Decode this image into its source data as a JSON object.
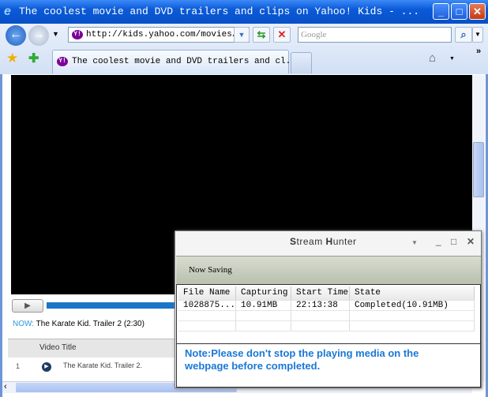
{
  "window": {
    "title": "The coolest movie and DVD trailers and clips on Yahoo! Kids - ..."
  },
  "toolbar": {
    "url": "http://kids.yahoo.com/movies/vi",
    "search_placeholder": "Google"
  },
  "tabs": [
    {
      "label": "The coolest movie and DVD trailers and cl..."
    }
  ],
  "player": {
    "now_label": "NOW:",
    "now_title": "The Karate Kid. Trailer 2 (2:30)",
    "progress": 0.6
  },
  "playlist": {
    "header": "Video Title",
    "rows": [
      {
        "num": "1",
        "title": "The Karate Kid. Trailer 2."
      }
    ]
  },
  "stream_hunter": {
    "title_s": "S",
    "title_tream": "tream ",
    "title_h": "H",
    "title_unter": "unter",
    "status": "Now Saving",
    "columns": [
      "File Name",
      "Capturing",
      "Start Time",
      "State"
    ],
    "rows": [
      {
        "file": "1028875...",
        "capturing": "10.91MB",
        "start": "22:13:38",
        "state": "Completed(10.91MB)"
      }
    ],
    "note": "Note:Please don't stop the playing media on the webpage before completed."
  }
}
